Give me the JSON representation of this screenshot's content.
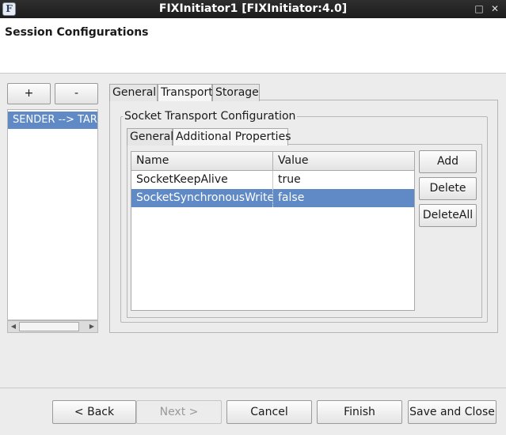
{
  "window": {
    "title": "FIXInitiator1 [FIXInitiator:4.0]",
    "icon_letter": "F",
    "minimize_glyph": "□",
    "close_glyph": "✕"
  },
  "header": {
    "title": "Session Configurations"
  },
  "session_buttons": {
    "add": "+",
    "remove": "-"
  },
  "sessions": [
    {
      "label": "SENDER --> TARGET",
      "selected": true
    }
  ],
  "scroll_arrows": {
    "left": "◀",
    "right": "▶"
  },
  "tabs": [
    {
      "label": "General",
      "active": false
    },
    {
      "label": "Transport",
      "active": true
    },
    {
      "label": "Storage",
      "active": false
    }
  ],
  "group": {
    "title": "Socket Transport Configuration"
  },
  "subtabs": [
    {
      "label": "General",
      "active": false
    },
    {
      "label": "Additional Properties",
      "active": true
    }
  ],
  "properties_table": {
    "columns": [
      "Name",
      "Value"
    ],
    "rows": [
      {
        "name": "SocketKeepAlive",
        "value": "true",
        "selected": false
      },
      {
        "name": "SocketSynchronousWrites",
        "value": "false",
        "selected": true
      }
    ]
  },
  "property_buttons": {
    "add": "Add",
    "delete": "Delete",
    "delete_all": "DeleteAll"
  },
  "footer": {
    "back": "< Back",
    "next": "Next >",
    "cancel": "Cancel",
    "finish": "Finish",
    "save_close": "Save and Close"
  },
  "colors": {
    "selection": "#5f8ac5",
    "titlebar": "#1c1c1c"
  }
}
